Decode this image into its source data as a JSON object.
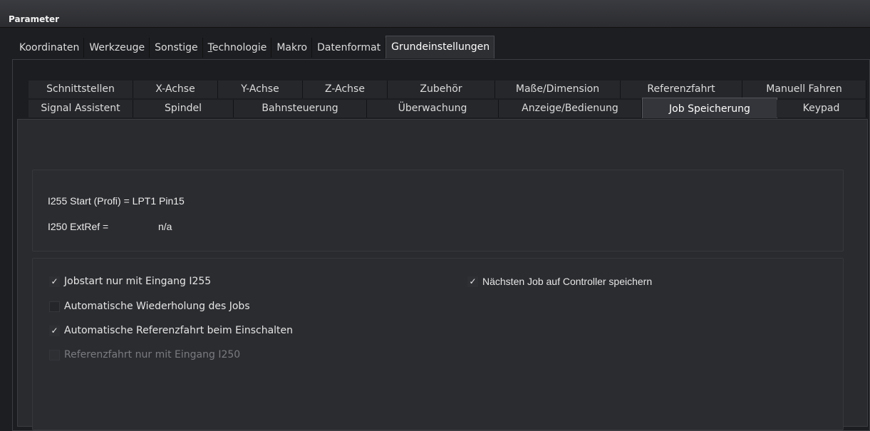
{
  "window": {
    "title": "Parameter"
  },
  "main_tabs": [
    {
      "label": "Koordinaten",
      "active": false
    },
    {
      "label": "Werkzeuge",
      "active": false
    },
    {
      "label": "Sonstige",
      "active": false
    },
    {
      "label": "Technologie",
      "active": false
    },
    {
      "label": "Makro",
      "active": false
    },
    {
      "label": "Datenformat",
      "active": false
    },
    {
      "label": "Grundeinstellungen",
      "active": true
    }
  ],
  "sub_tabs_row1": [
    {
      "label": "Schnittstellen"
    },
    {
      "label": "X-Achse"
    },
    {
      "label": "Y-Achse"
    },
    {
      "label": "Z-Achse"
    },
    {
      "label": "Zubehör"
    },
    {
      "label": "Maße/Dimension"
    },
    {
      "label": "Referenzfahrt"
    },
    {
      "label": "Manuell Fahren"
    }
  ],
  "sub_tabs_row2": [
    {
      "label": "Signal Assistent"
    },
    {
      "label": "Spindel"
    },
    {
      "label": "Bahnsteuerung"
    },
    {
      "label": "Überwachung"
    },
    {
      "label": "Anzeige/Bedienung"
    },
    {
      "label": "Job Speicherung",
      "active": true
    },
    {
      "label": "Keypad"
    }
  ],
  "info": {
    "start_label": "I255 Start (Profi) = LPT1 Pin15",
    "extref_label": "I250 ExtRef =",
    "extref_value": "n/a"
  },
  "options": {
    "jobstart": {
      "label": "Jobstart nur mit Eingang I255",
      "checked": true
    },
    "wiederholung": {
      "label": "Automatische Wiederholung des Jobs",
      "checked": false
    },
    "referenzfahrt_einschalten": {
      "label": "Automatische Referenzfahrt beim Einschalten",
      "checked": true
    },
    "referenzfahrt_eingang": {
      "label": "Referenzfahrt nur mit Eingang I250",
      "checked": false,
      "disabled": true
    },
    "naechsten_job": {
      "label": "Nächsten Job auf Controller speichern",
      "checked": true
    }
  },
  "colors": {
    "background": "#1d1e22",
    "panel": "#2b2c30",
    "text": "#e3e3e3",
    "disabled_text": "#7a7b80"
  }
}
